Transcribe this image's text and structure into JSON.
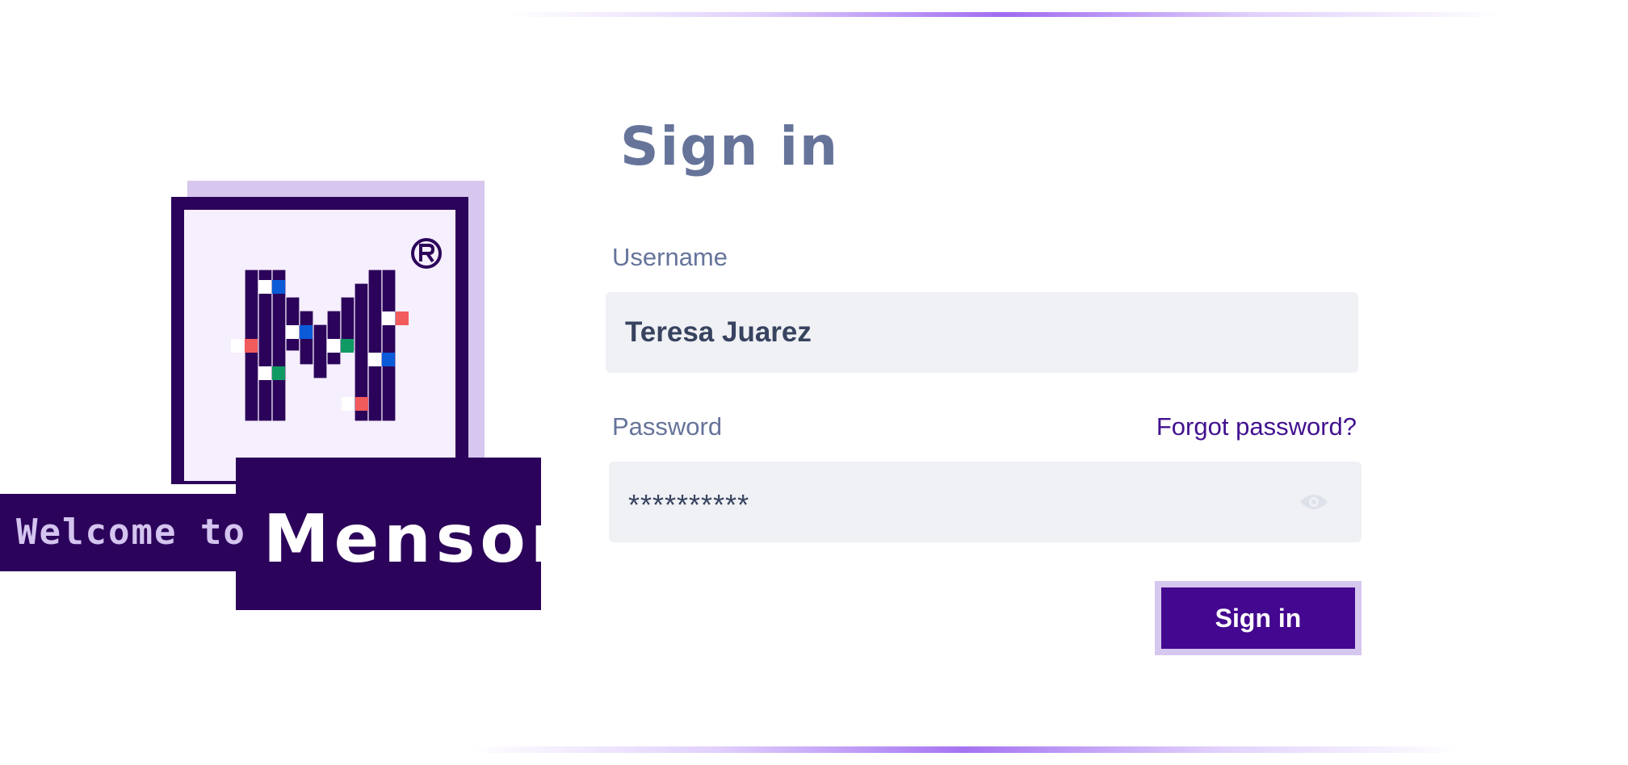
{
  "brand": {
    "welcome_text": "Welcome to",
    "name": "Menson",
    "logo_icon": "menson-pixel-m-logo",
    "registered_icon": "registered-trademark-icon"
  },
  "form": {
    "title": "Sign in",
    "username": {
      "label": "Username",
      "value": "Teresa Juarez"
    },
    "password": {
      "label": "Password",
      "value": "**********",
      "toggle_icon": "eye-icon"
    },
    "forgot_link": "Forgot password?",
    "submit_label": "Sign in"
  },
  "colors": {
    "brand_dark": "#2c035a",
    "accent_purple": "#43088f",
    "accent_light": "#d6c7ef",
    "title_gray": "#66749a",
    "input_bg": "#eff1f5",
    "pixel_blue": "#0b5bd9",
    "pixel_red": "#f25b5b",
    "pixel_green": "#0f9a63"
  }
}
